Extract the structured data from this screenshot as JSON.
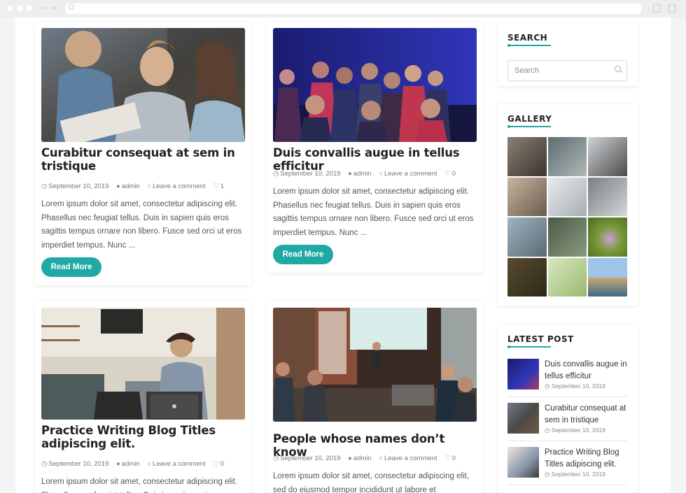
{
  "search": {
    "title": "SEARCH",
    "placeholder": "Search"
  },
  "gallery": {
    "title": "GALLERY"
  },
  "latest": {
    "title": "LATEST POST",
    "items": [
      {
        "title": "Duis convallis augue in tellus efficitur",
        "date": "September 10, 2019"
      },
      {
        "title": "Curabitur consequat at sem in tristique",
        "date": "September 10, 2019"
      },
      {
        "title": "Practice Writing Blog Titles adipiscing elit.",
        "date": "September 10, 2019"
      }
    ]
  },
  "posts": [
    {
      "title": "Curabitur consequat at sem in tristique",
      "date": "September 10, 2019",
      "author": "admin",
      "comment": "Leave a comment",
      "likes": "1",
      "excerpt": "Lorem ipsum dolor sit amet, consectetur adipiscing elit. Phasellus nec feugiat tellus. Duis in sapien quis eros sagittis tempus ornare non libero. Fusce sed orci ut eros imperdiet tempus. Nunc ...",
      "read_more": "Read More"
    },
    {
      "title": "Duis convallis augue in tellus efficitur",
      "date": "September 10, 2019",
      "author": "admin",
      "comment": "Leave a comment",
      "likes": "0",
      "excerpt": "Lorem ipsum dolor sit amet, consectetur adipiscing elit. Phasellus nec feugiat tellus. Duis in sapien quis eros sagittis tempus ornare non libero. Fusce sed orci ut eros imperdiet tempus. Nunc ...",
      "read_more": "Read More"
    },
    {
      "title": "Practice Writing Blog Titles adipiscing elit.",
      "date": "September 10, 2019",
      "author": "admin",
      "comment": "Leave a comment",
      "likes": "0",
      "excerpt": "Lorem ipsum dolor sit amet, consectetur adipiscing elit. Phasellus nec feugiat tellus. Duis in sapien quis"
    },
    {
      "title": "People whose names don’t know",
      "date": "September 10, 2019",
      "author": "admin",
      "comment": "Leave a comment",
      "likes": "0",
      "excerpt": "Lorem ipsum dolor sit amet, consectetur adipiscing elit, sed do eiusmod tempor incididunt ut labore et"
    }
  ],
  "colors": {
    "accent": "#1fa9a5"
  }
}
